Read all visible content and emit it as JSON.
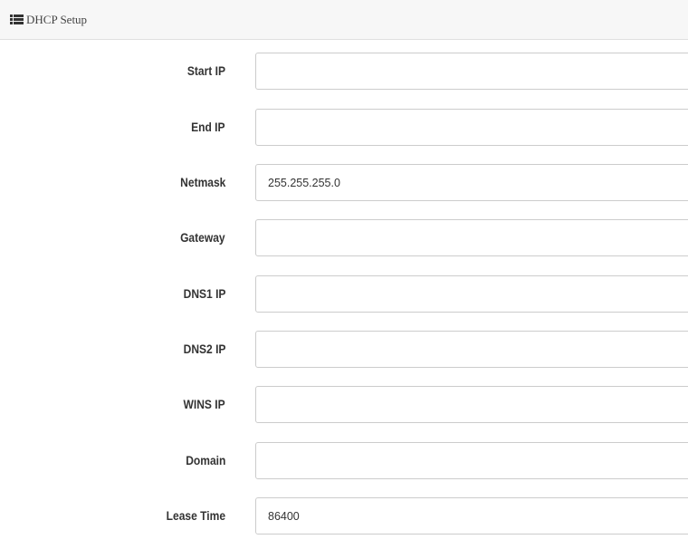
{
  "panel": {
    "title": "DHCP Setup",
    "icon": "list-icon"
  },
  "form": {
    "fields": [
      {
        "key": "start_ip",
        "label": "Start IP",
        "value": ""
      },
      {
        "key": "end_ip",
        "label": "End IP",
        "value": ""
      },
      {
        "key": "netmask",
        "label": "Netmask",
        "value": "255.255.255.0"
      },
      {
        "key": "gateway",
        "label": "Gateway",
        "value": ""
      },
      {
        "key": "dns1_ip",
        "label": "DNS1 IP",
        "value": ""
      },
      {
        "key": "dns2_ip",
        "label": "DNS2 IP",
        "value": ""
      },
      {
        "key": "wins_ip",
        "label": "WINS IP",
        "value": ""
      },
      {
        "key": "domain",
        "label": "Domain",
        "value": ""
      },
      {
        "key": "lease_time",
        "label": "Lease Time",
        "value": "86400"
      }
    ]
  },
  "colors": {
    "header_background": "#f7f7f7",
    "border": "#cccccc",
    "text": "#333333"
  }
}
